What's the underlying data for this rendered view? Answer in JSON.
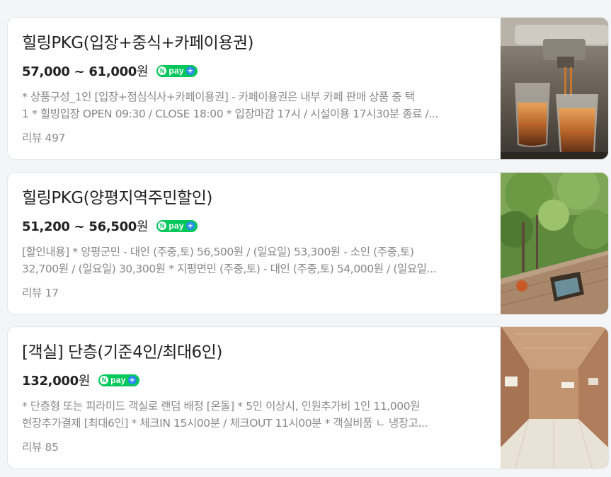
{
  "listings": [
    {
      "title": "힐링PKG(입장+중식+카페이용권)",
      "price": "57,000 ~ 61,000",
      "currency": "원",
      "pay_badge": "pay",
      "desc_line1": "* 상품구성_1인 [입장+점심식사+카페이용권] - 카페이용권은 내부 카페 판매 상품 중 택",
      "desc_line2": "1 * 힐빙입장 OPEN 09:30 / CLOSE 18:00 * 입장마감 17시 / 시설이용 17시30분 종료 /...",
      "review": "리뷰 497",
      "image_icon": "espresso-photo"
    },
    {
      "title": "힐링PKG(양평지역주민할인)",
      "price": "51,200 ~ 56,500",
      "currency": "원",
      "pay_badge": "pay",
      "desc_line1": "[할인내용] * 양평군민 - 대인 (주중,토) 56,500원 / (일요일) 53,300원 - 소인 (주중,토)",
      "desc_line2": "32,700원 / (일요일) 30,300원 * 지평면민 (주중,토) - 대인 (주중,토) 54,000원 / (일요일...",
      "review": "리뷰 17",
      "image_icon": "garden-deck-photo"
    },
    {
      "title": "[객실] 단층(기준4인/최대6인)",
      "price": "132,000",
      "currency": "원",
      "pay_badge": "pay",
      "desc_line1": "* 단층형 또는 피라미드 객실로 랜덤 배정 [온돌] * 5인 이상시, 인원추가비 1인 11,000원",
      "desc_line2": "현장추가결제 [최대6인] * 체크IN 15시00분 / 체크OUT 11시00분 * 객실비품 ㄴ 냉장고...",
      "review": "리뷰 85",
      "image_icon": "room-interior-photo"
    }
  ],
  "colors": {
    "npay_green": "#03c75a",
    "npay_plus_blue": "#2b8af0",
    "title": "#222222",
    "desc": "#888888"
  }
}
